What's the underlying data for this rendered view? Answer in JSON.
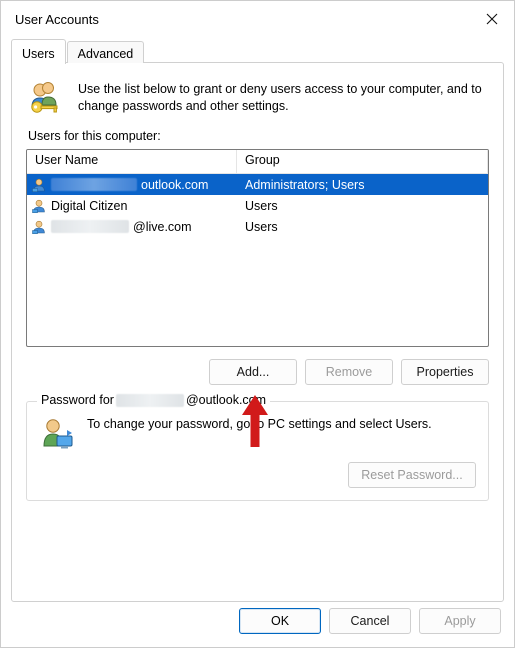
{
  "window": {
    "title": "User Accounts"
  },
  "tabs": {
    "users": "Users",
    "advanced": "Advanced"
  },
  "intro": "Use the list below to grant or deny users access to your computer, and to change passwords and other settings.",
  "section_label": "Users for this computer:",
  "columns": {
    "name": "User Name",
    "group": "Group"
  },
  "rows": [
    {
      "name_prefix_hidden_width": 86,
      "name_suffix": "outlook.com",
      "group": "Administrators; Users",
      "selected": true,
      "icon": "ms-account"
    },
    {
      "name": "Digital Citizen",
      "group": "Users",
      "selected": false,
      "icon": "ms-account"
    },
    {
      "name_prefix_hidden_width": 78,
      "name_suffix": "@live.com",
      "group": "Users",
      "selected": false,
      "icon": "ms-account"
    }
  ],
  "buttons": {
    "add": "Add...",
    "remove": "Remove",
    "properties": "Properties"
  },
  "password_group": {
    "legend_prefix": "Password for",
    "legend_hidden_width": 68,
    "legend_suffix": "@outlook.com",
    "message": "To change your password, go to PC settings and select Users.",
    "reset": "Reset Password..."
  },
  "footer": {
    "ok": "OK",
    "cancel": "Cancel",
    "apply": "Apply"
  },
  "icons": {
    "close": "close-icon",
    "users_key": "users-key-icon",
    "user_small": "user-account-icon",
    "user_arrow": "user-monitor-icon",
    "pointer_arrow": "red-arrow-annotation"
  }
}
